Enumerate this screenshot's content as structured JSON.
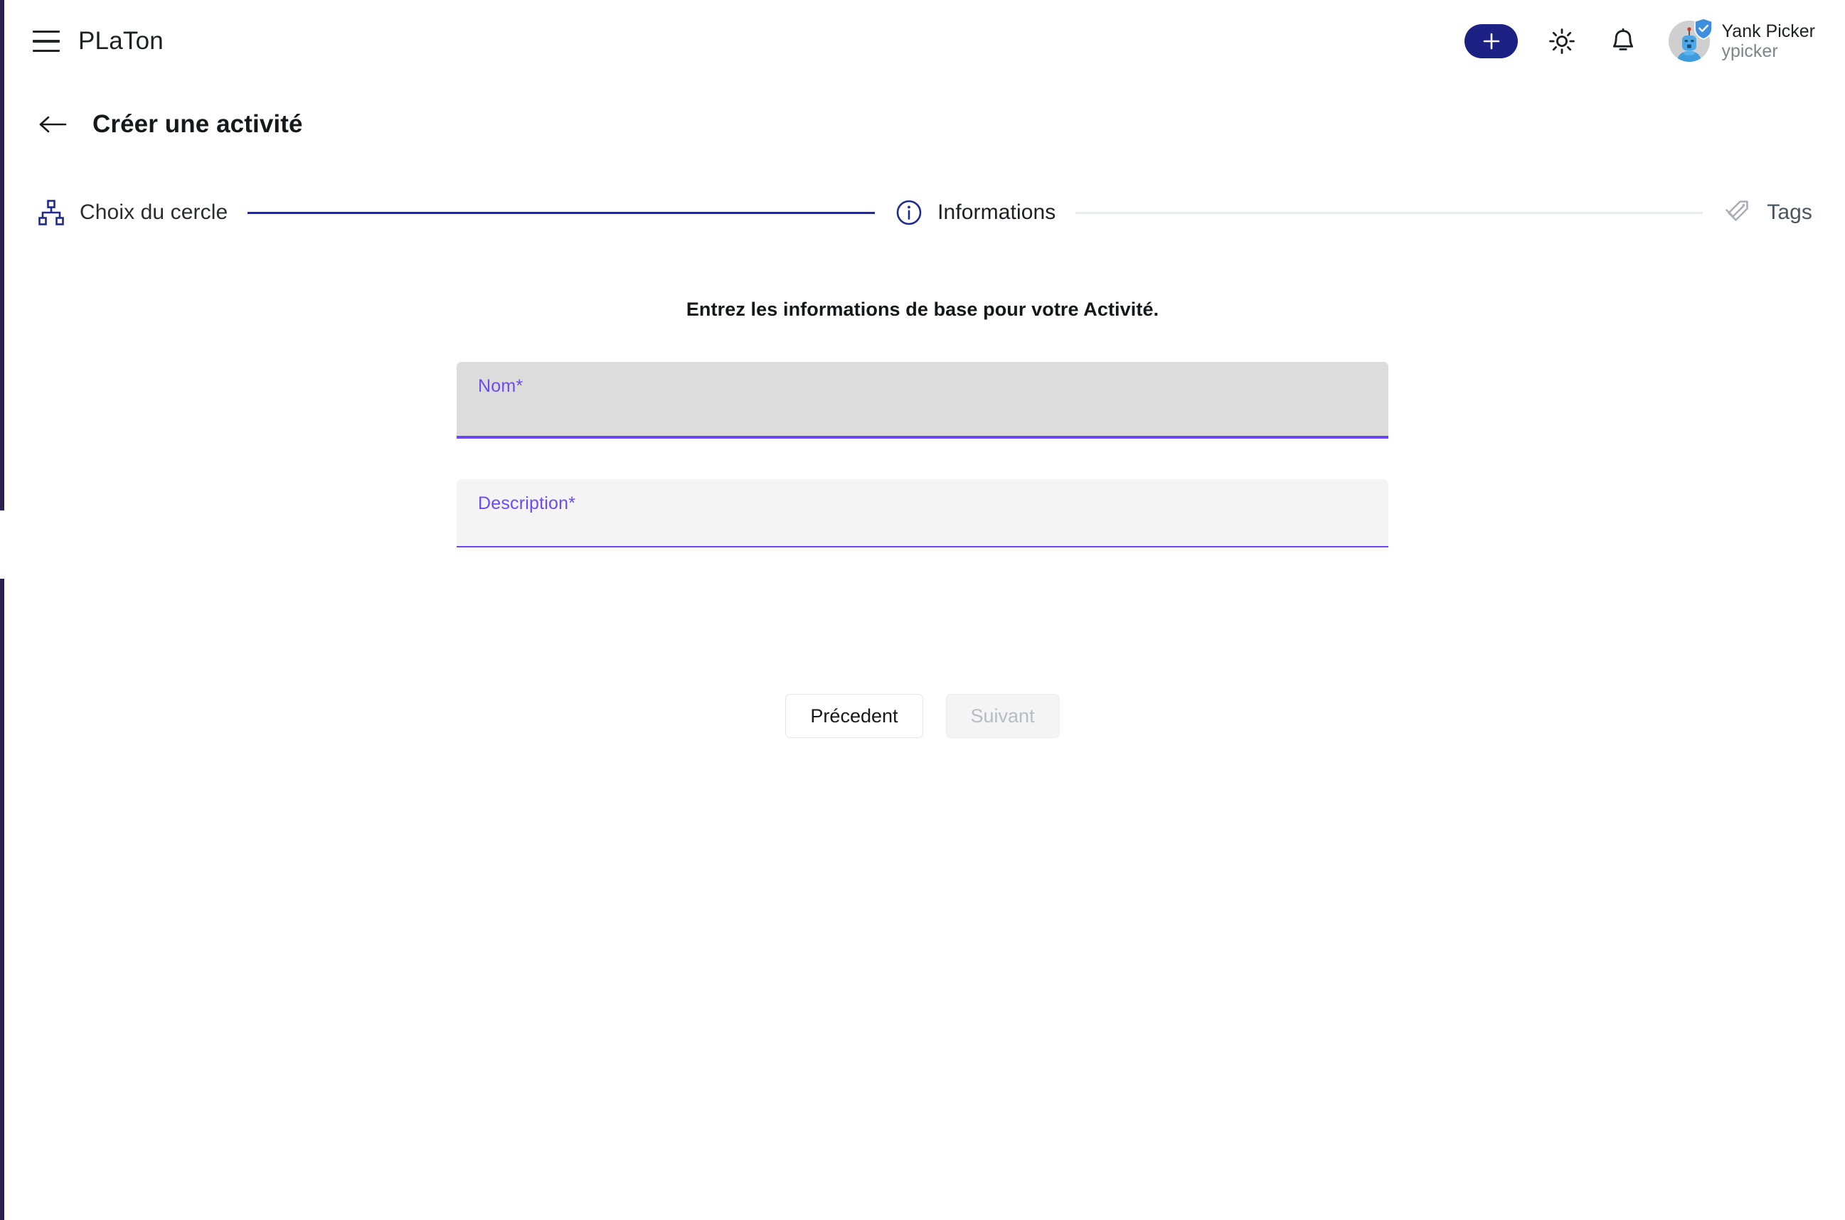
{
  "appbar": {
    "menu_icon": "hamburger-menu-icon",
    "brand": "PLaTon",
    "add_button_label": "+",
    "add_icon": "plus-icon",
    "theme_icon": "sun-icon",
    "notifications_icon": "bell-icon",
    "avatar_icon": "robot-avatar",
    "avatar_badge_icon": "shield-check-icon",
    "user_fullname": "Yank Picker",
    "user_handle": "ypicker",
    "accent_color": "#1b2283"
  },
  "page": {
    "back_icon": "arrow-left-icon",
    "title": "Créer une activité"
  },
  "stepper": {
    "steps": [
      {
        "label": "Choix du cercle",
        "icon": "sitemap-icon",
        "state": "done"
      },
      {
        "label": "Informations",
        "icon": "info-circle-icon",
        "state": "active"
      },
      {
        "label": "Tags",
        "icon": "tags-icon",
        "state": "todo"
      }
    ],
    "connector_done_color": "#1f2b8a",
    "connector_todo_color": "#e9eaec"
  },
  "form": {
    "intro": "Entrez les informations de base pour votre Activité.",
    "fields": [
      {
        "label": "Nom",
        "required_marker": "*",
        "value": "",
        "placeholder": "Nom",
        "focused": true,
        "background": "#dcdcdc",
        "underline_color": "#6b46f5"
      },
      {
        "label": "Description",
        "required_marker": "*",
        "value": "",
        "placeholder": "Description",
        "focused": false,
        "background": "#f4f4f4",
        "underline_color": "#6b46f5"
      }
    ]
  },
  "actions": {
    "previous_label": "Précedent",
    "next_label": "Suivant",
    "next_disabled": true
  }
}
